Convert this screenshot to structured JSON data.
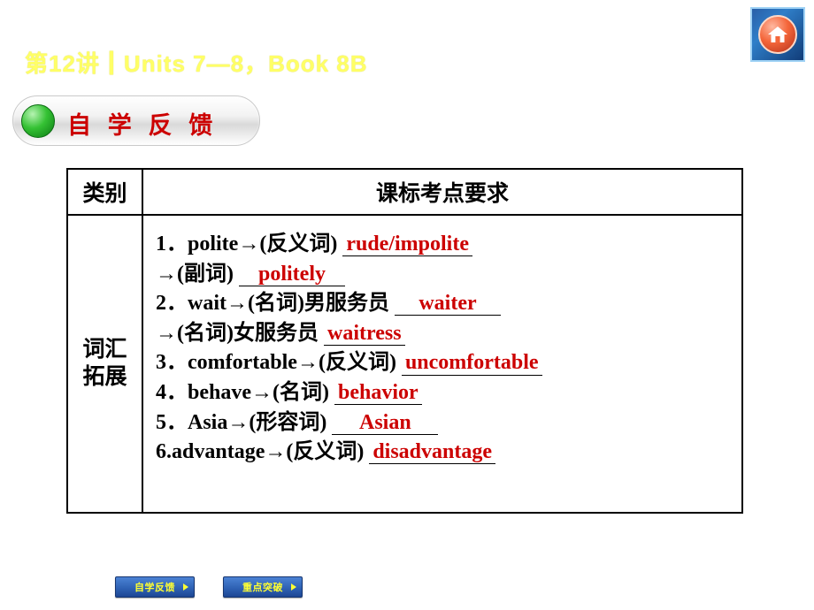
{
  "header": {
    "title": "第12讲┃Units 7—8，Book 8B"
  },
  "home_button": {
    "icon": "home-icon"
  },
  "banner": {
    "label": "自 学 反 馈"
  },
  "table": {
    "headers": [
      "类别",
      "课标考点要求"
    ],
    "category": "词汇\n拓展",
    "category_line1": "词汇",
    "category_line2": "拓展",
    "items": [
      {
        "prompt": "1．polite→(反义词)",
        "answer": "rude/impolite"
      },
      {
        "prompt": "→(副词)",
        "answer": "politely"
      },
      {
        "prompt": "2．wait→(名词)男服务员",
        "answer": "waiter"
      },
      {
        "prompt": "→(名词)女服务员",
        "answer": "waitress"
      },
      {
        "prompt": "3．comfortable→(反义词)",
        "answer": "uncomfortable"
      },
      {
        "prompt": "4．behave→(名词)",
        "answer": "behavior"
      },
      {
        "prompt": "5．Asia→(形容词)",
        "answer": "Asian"
      },
      {
        "prompt": "6.advantage→(反义词)",
        "answer": "disadvantage"
      }
    ]
  },
  "footer": {
    "buttons": [
      {
        "label": "自学反馈"
      },
      {
        "label": "重点突破"
      }
    ]
  },
  "colors": {
    "header_title": "#ffff66",
    "answer_red": "#cc0000",
    "banner_text": "#cc0000",
    "footer_label": "#ffff33"
  }
}
